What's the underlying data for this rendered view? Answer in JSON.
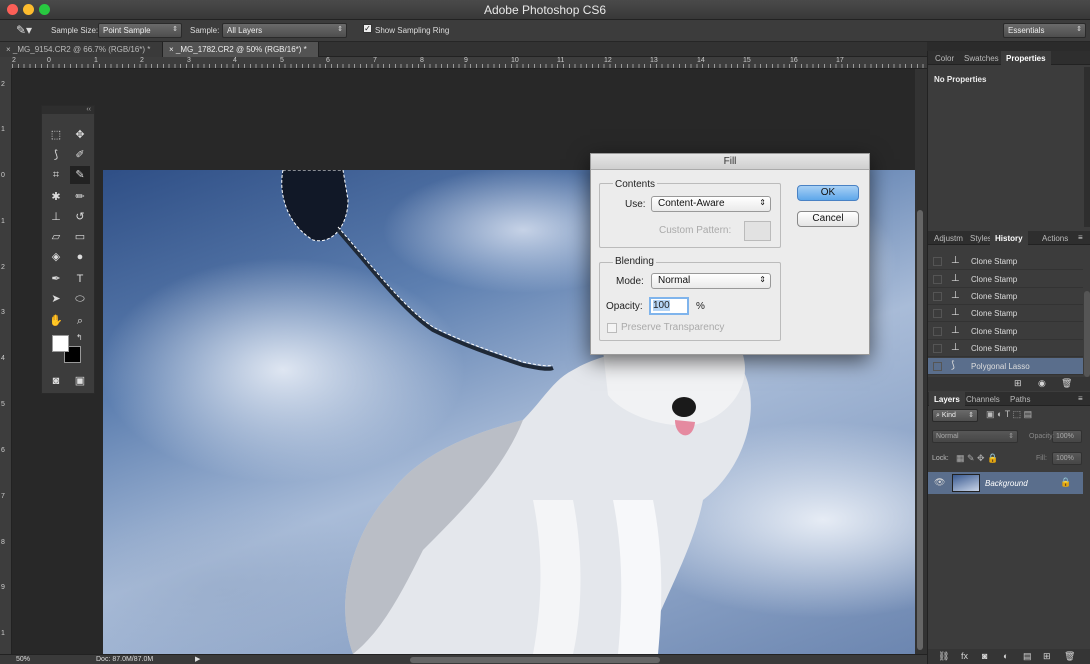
{
  "app": {
    "title": "Adobe Photoshop CS6"
  },
  "options": {
    "sample_size_label": "Sample Size:",
    "sample_size_value": "Point Sample",
    "sample_label": "Sample:",
    "sample_value": "All Layers",
    "show_ring_label": "Show Sampling Ring",
    "show_ring_checked": true,
    "workspace": "Essentials"
  },
  "tabs": [
    {
      "label": "_MG_9154.CR2 @ 66.7% (RGB/16*) *",
      "active": false
    },
    {
      "label": "_MG_1782.CR2 @ 50% (RGB/16*) *",
      "active": true
    }
  ],
  "rulers": {
    "h": [
      "2",
      "0",
      "1",
      "2",
      "3",
      "4",
      "5",
      "6",
      "7",
      "8",
      "9",
      "10",
      "11",
      "12",
      "13",
      "14",
      "15",
      "16",
      "17"
    ],
    "v": [
      "2",
      "1",
      "0",
      "1",
      "2",
      "3",
      "4",
      "5",
      "6",
      "7",
      "8",
      "9",
      "1"
    ]
  },
  "status": {
    "zoom": "50%",
    "doc": "Doc: 87.0M/87.0M"
  },
  "properties_panel": {
    "tabs": [
      "Color",
      "Swatches",
      "Properties"
    ],
    "active": "Properties",
    "body": "No Properties"
  },
  "history_panel": {
    "tabs": [
      "Adjustm",
      "Styles",
      "History",
      "Actions"
    ],
    "active": "History",
    "items": [
      "Clone Stamp",
      "Clone Stamp",
      "Clone Stamp",
      "Clone Stamp",
      "Clone Stamp",
      "Clone Stamp",
      "Polygonal Lasso"
    ],
    "selected_index": 6
  },
  "layers_panel": {
    "tabs": [
      "Layers",
      "Channels",
      "Paths"
    ],
    "active": "Layers",
    "kind_label": "Kind",
    "blend_mode": "Normal",
    "opacity_label": "Opacity:",
    "opacity_value": "100%",
    "lock_label": "Lock:",
    "fill_label": "Fill:",
    "fill_value": "100%",
    "layers": [
      {
        "name": "Background",
        "locked": true,
        "visible": true
      }
    ]
  },
  "fill_dialog": {
    "title": "Fill",
    "contents_label": "Contents",
    "use_label": "Use:",
    "use_value": "Content-Aware",
    "custom_pattern_label": "Custom Pattern:",
    "blending_label": "Blending",
    "mode_label": "Mode:",
    "mode_value": "Normal",
    "opacity_label": "Opacity:",
    "opacity_value": "100",
    "opacity_unit": "%",
    "preserve_label": "Preserve Transparency",
    "preserve_checked": false,
    "ok_label": "OK",
    "cancel_label": "Cancel"
  },
  "colors": {
    "accent": "#5ea7ea",
    "history_selected": "#5a6e8c"
  }
}
